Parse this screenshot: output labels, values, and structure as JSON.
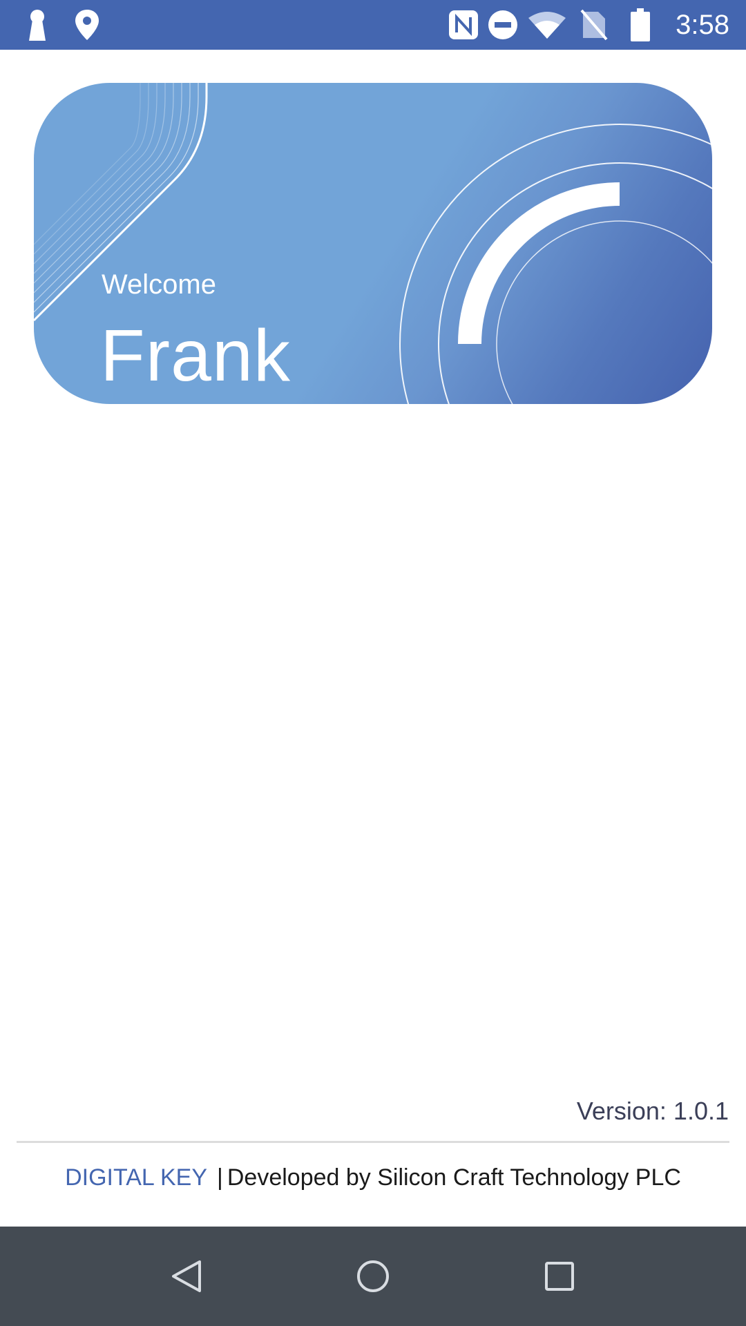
{
  "status_bar": {
    "time": "3:58",
    "icons_left": [
      "keyhole-icon",
      "location-pin-icon"
    ],
    "icons_right": [
      "nfc-icon",
      "do-not-disturb-icon",
      "wifi-icon",
      "no-sim-icon",
      "battery-icon"
    ],
    "background_color": "#4466b0"
  },
  "card": {
    "welcome_label": "Welcome",
    "user_name": "Frank",
    "gradient_colors": [
      "#72a4d8",
      "#4562ae"
    ]
  },
  "footer": {
    "version": "Version: 1.0.1",
    "brand": "DIGITAL KEY",
    "separator": "|",
    "credit": "Developed by Silicon Craft Technology PLC",
    "brand_color": "#4466b0"
  },
  "nav_bar": {
    "buttons": [
      "back-icon",
      "home-icon",
      "recents-icon"
    ],
    "background_color": "#444b53"
  }
}
